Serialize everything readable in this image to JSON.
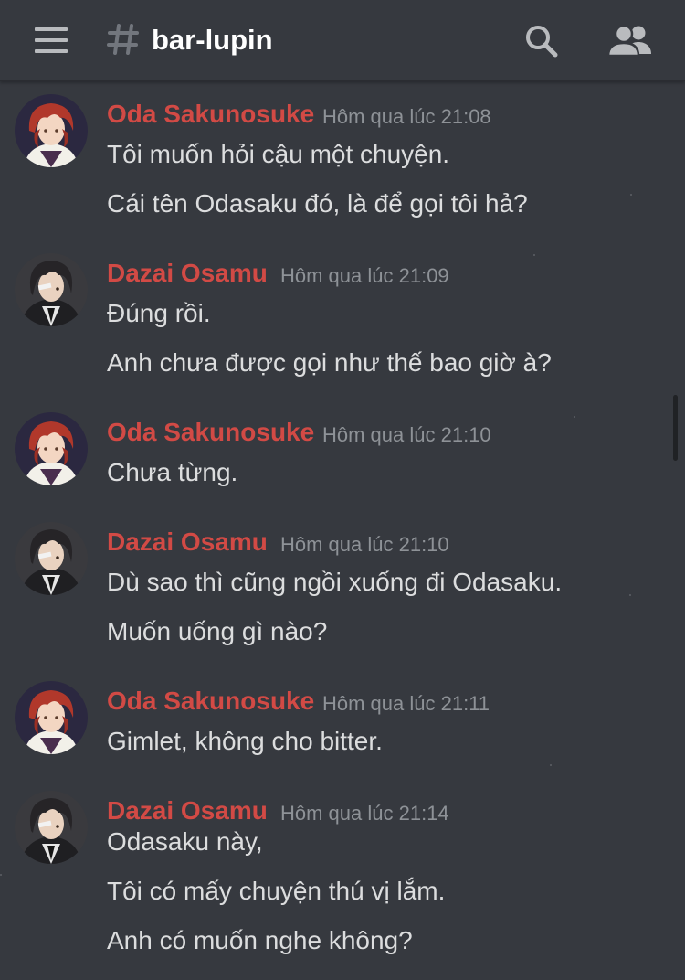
{
  "header": {
    "menu_icon": "hamburger-menu-icon",
    "hash_icon": "hash-icon",
    "channel_name": "bar-lupin",
    "search_icon": "search-icon",
    "members_icon": "members-icon"
  },
  "colors": {
    "background": "#36393f",
    "username": "#d24a45",
    "message_text": "#dcddde",
    "timestamp": "#8e9297"
  },
  "messages": [
    {
      "author": "Oda Sakunosuke",
      "time": "Hôm qua lúc 21:08",
      "lines": [
        "Tôi muốn hỏi cậu một chuyện.",
        "Cái tên Odasaku đó, là để gọi tôi hả?"
      ]
    },
    {
      "author": "Dazai Osamu",
      "time": "Hôm qua lúc 21:09",
      "lines": [
        "Đúng rồi.",
        "Anh chưa được gọi như thế bao giờ à?"
      ]
    },
    {
      "author": "Oda Sakunosuke",
      "time": "Hôm qua lúc 21:10",
      "lines": [
        "Chưa từng."
      ]
    },
    {
      "author": "Dazai Osamu",
      "time": "Hôm qua lúc 21:10",
      "lines": [
        "Dù sao thì cũng ngồi xuống đi Odasaku.",
        "Muốn uống gì nào?"
      ]
    },
    {
      "author": "Oda Sakunosuke",
      "time": "Hôm qua lúc 21:11",
      "lines": [
        "Gimlet, không cho bitter."
      ]
    },
    {
      "author": "Dazai Osamu",
      "time": "Hôm qua lúc 21:14",
      "lines": [
        "Odasaku này,",
        "Tôi có mấy chuyện thú vị lắm.",
        "Anh có muốn nghe không?"
      ]
    }
  ]
}
